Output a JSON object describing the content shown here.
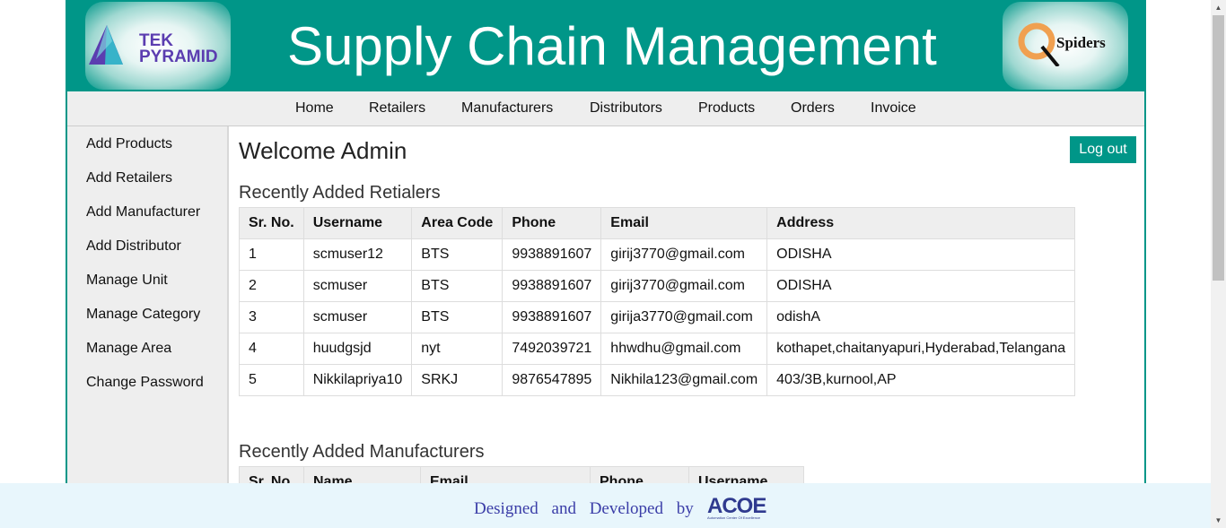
{
  "header": {
    "title": "Supply Chain Management",
    "logo_left": {
      "line1": "TEK",
      "line2": "PYRAMID"
    },
    "logo_right": {
      "text": "Spiders"
    }
  },
  "nav": {
    "items": [
      "Home",
      "Retailers",
      "Manufacturers",
      "Distributors",
      "Products",
      "Orders",
      "Invoice"
    ]
  },
  "sidebar": {
    "items": [
      "Add Products",
      "Add Retailers",
      "Add Manufacturer",
      "Add Distributor",
      "Manage Unit",
      "Manage Category",
      "Manage Area",
      "Change Password"
    ]
  },
  "main": {
    "welcome": "Welcome Admin",
    "logout_label": "Log out",
    "retailers": {
      "title": "Recently Added Retialers",
      "columns": [
        "Sr. No.",
        "Username",
        "Area Code",
        "Phone",
        "Email",
        "Address"
      ],
      "rows": [
        [
          "1",
          "scmuser12",
          "BTS",
          "9938891607",
          "girij3770@gmail.com",
          "ODISHA"
        ],
        [
          "2",
          "scmuser",
          "BTS",
          "9938891607",
          "girij3770@gmail.com",
          "ODISHA"
        ],
        [
          "3",
          "scmuser",
          "BTS",
          "9938891607",
          "girija3770@gmail.com",
          "odishA"
        ],
        [
          "4",
          "huudgsjd",
          "nyt",
          "7492039721",
          "hhwdhu@gmail.com",
          "kothapet,chaitanyapuri,Hyderabad,Telangana"
        ],
        [
          "5",
          "Nikkilapriya10",
          "SRKJ",
          "9876547895",
          "Nikhila123@gmail.com",
          "403/3B,kurnool,AP"
        ]
      ]
    },
    "manufacturers": {
      "title": "Recently Added Manufacturers",
      "columns": [
        "Sr. No.",
        "Name",
        "Email",
        "Phone",
        "Username"
      ]
    }
  },
  "footer": {
    "text": "Designed and Developed by",
    "logo": "ACOE",
    "logo_sub": "Automation Center Of Excellence"
  },
  "colors": {
    "brand": "#009688",
    "nav_bg": "#eeeeee",
    "footer_bg": "#e8f6fc",
    "footer_text": "#3b3ea8"
  }
}
